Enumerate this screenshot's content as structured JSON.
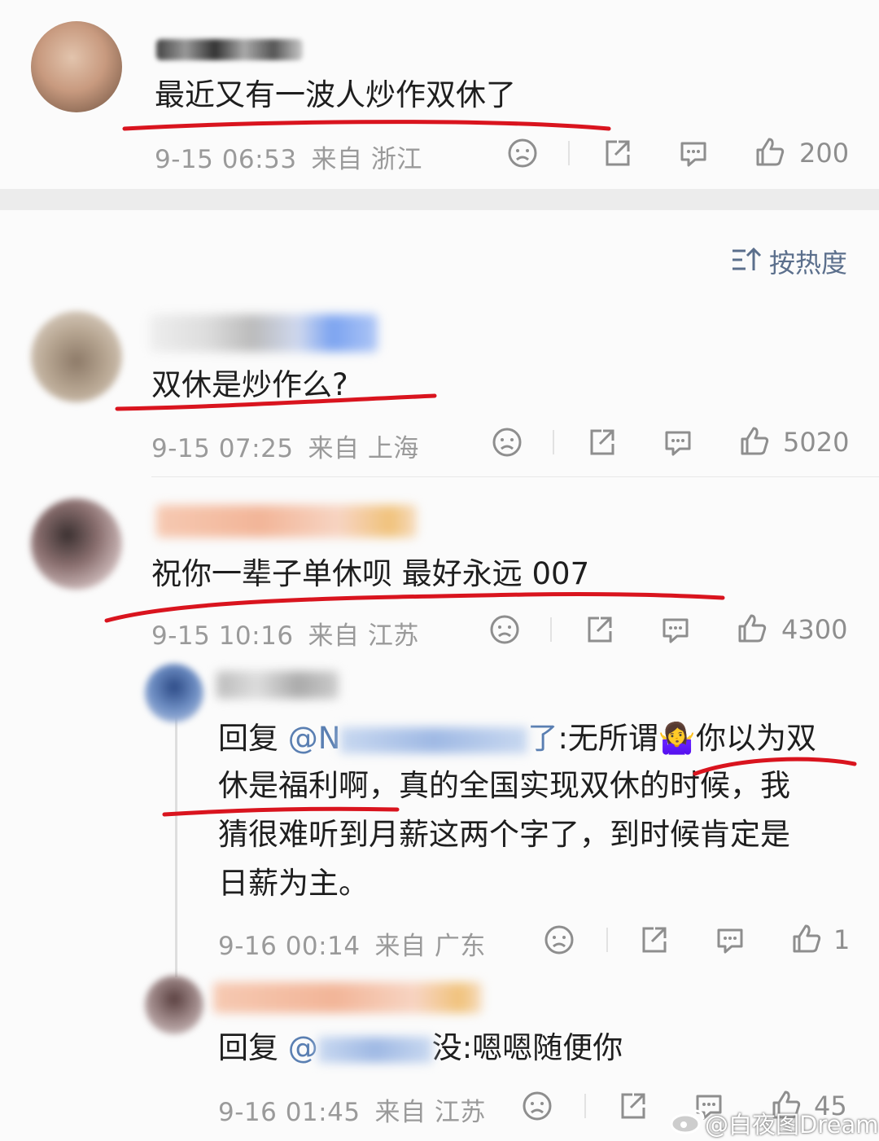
{
  "post": {
    "text": "最近又有一波人炒作双休了",
    "time": "9-15 06:53",
    "region": "来自 浙江",
    "likes": "200"
  },
  "sort_label": "按热度",
  "comments": [
    {
      "text": "双休是炒作么?",
      "time": "9-15 07:25",
      "region": "来自 上海",
      "likes": "5020"
    },
    {
      "text": "祝你一辈子单休呗 最好永远 007",
      "time": "9-15 10:16",
      "region": "来自 江苏",
      "likes": "4300"
    }
  ],
  "replies": [
    {
      "prefix": "回复 ",
      "mention_start": "@N",
      "mention_end": "了",
      "line1_rest": ":无所谓",
      "emoji": "🤷‍♀️",
      "line1_end": "你以为双",
      "line2": "休是福利啊，真的全国实现双休的时候，我",
      "line3": "猜很难听到月薪这两个字了，到时候肯定是",
      "line4": "日薪为主。",
      "time": "9-16 00:14",
      "region": "来自 广东",
      "likes": "1"
    },
    {
      "prefix": "回复 ",
      "mention_start": "@",
      "mention_end": "",
      "text_rest": "没:嗯嗯随便你",
      "time": "9-16 01:45",
      "region": "来自 江苏",
      "likes": "45"
    }
  ],
  "watermark": "@白夜图Dream",
  "colors": {
    "underline": "#d9141e",
    "divider": "#ececec",
    "mention": "#5a7fb2"
  }
}
